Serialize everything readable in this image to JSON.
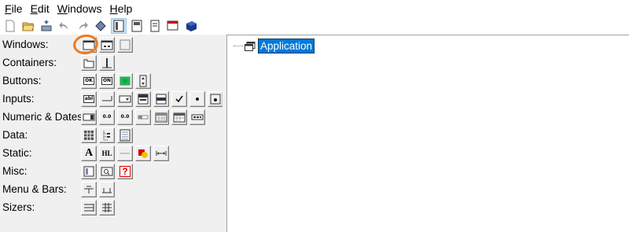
{
  "menu": [
    "File",
    "Edit",
    "Windows",
    "Help"
  ],
  "toolbar": {
    "buttons": [
      {
        "name": "new-file-icon",
        "active": false
      },
      {
        "name": "open-folder-icon",
        "active": false
      },
      {
        "name": "save-icon",
        "active": false
      },
      {
        "name": "undo-icon",
        "active": false
      },
      {
        "name": "redo-icon",
        "active": false
      },
      {
        "name": "generate-code-icon",
        "active": false
      },
      {
        "name": "layout-view-icon",
        "active": true
      },
      {
        "name": "design-view-icon",
        "active": false
      },
      {
        "name": "properties-icon",
        "active": false
      },
      {
        "name": "preview-icon",
        "active": false
      },
      {
        "name": "manual-icon",
        "active": false
      }
    ]
  },
  "palette": {
    "rows": [
      {
        "label": "Windows:",
        "buttons": [
          "frame-icon",
          "dialog-icon",
          "panel-icon"
        ]
      },
      {
        "label": "Containers:",
        "buttons": [
          "notebook-icon",
          "splitter-window-icon"
        ]
      },
      {
        "label": "Buttons:",
        "buttons": [
          "button-icon",
          "toggle-button-icon",
          "bitmap-button-icon",
          "spin-button-icon"
        ]
      },
      {
        "label": "Inputs:",
        "buttons": [
          "text-ctrl-icon",
          "combo-box-icon",
          "choice-icon",
          "list-box-icon",
          "check-list-box-icon",
          "check-box-icon",
          "radio-button-icon",
          "radio-box-icon"
        ]
      },
      {
        "label": "Numeric & Dates:",
        "buttons": [
          "spin-ctrl-icon",
          "spin-ctrl-double-icon",
          "slider-icon",
          "gauge-icon",
          "calendar-ctrl-icon",
          "date-picker-icon",
          "time-picker-icon"
        ]
      },
      {
        "label": "Data:",
        "buttons": [
          "grid-icon",
          "tree-ctrl-icon",
          "list-ctrl-icon"
        ]
      },
      {
        "label": "Static:",
        "buttons": [
          "static-text-icon",
          "hyperlink-icon",
          "static-line-icon",
          "static-bitmap-icon",
          "spacer-icon"
        ]
      },
      {
        "label": "Misc:",
        "buttons": [
          "custom-widget-icon",
          "search-ctrl-icon",
          "help-button-icon"
        ]
      },
      {
        "label": "Menu & Bars:",
        "buttons": [
          "menu-bar-icon",
          "tool-bar-icon"
        ]
      },
      {
        "label": "Sizers:",
        "buttons": [
          "box-sizer-icon",
          "grid-sizer-icon"
        ]
      }
    ],
    "labels": {
      "ok": "OK",
      "on": "ON",
      "abl": "abl",
      "zero": "0.0",
      "hl": "HL",
      "a": "A",
      "q": "?"
    }
  },
  "tree": {
    "root_label": "Application"
  }
}
